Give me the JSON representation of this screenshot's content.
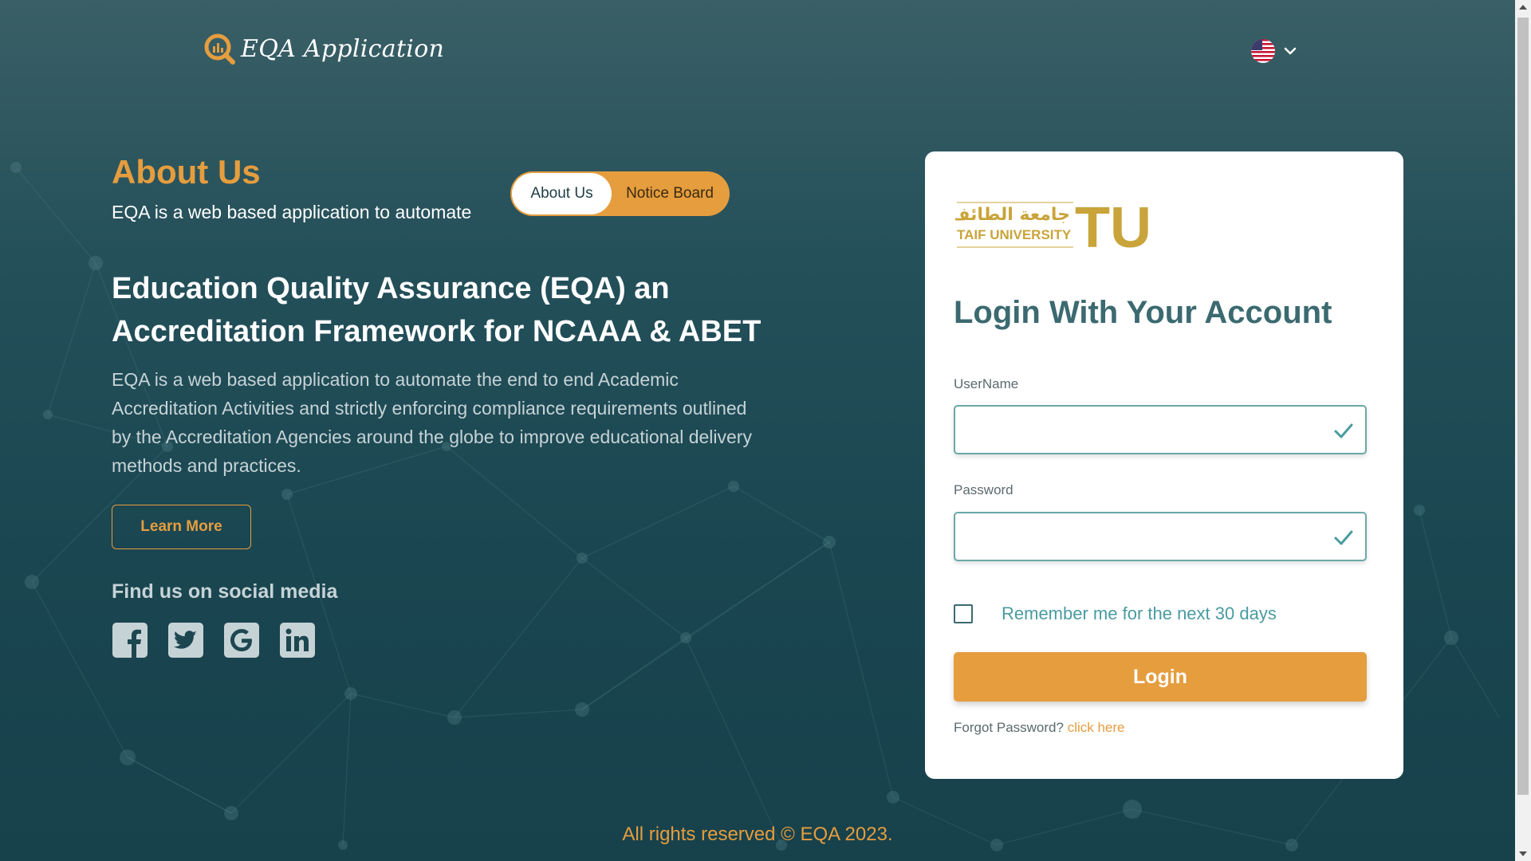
{
  "header": {
    "brand_title": "EQA Application",
    "language_flag": "us-flag-icon"
  },
  "about": {
    "heading": "About Us",
    "subtitle": "EQA is a web based application to automate",
    "toggle": [
      "About Us",
      "Notice Board"
    ],
    "title": "Education Quality Assurance (EQA) an Accreditation Framework for NCAAA & ABET",
    "description": "EQA is a web based application to automate the end to end Academic Accreditation Activities and strictly enforcing compliance requirements outlined by the Accreditation Agencies around the globe to improve educational delivery methods and practices.",
    "learn_more": "Learn More"
  },
  "social": {
    "heading": "Find us on social media",
    "icons": [
      "facebook-icon",
      "twitter-icon",
      "google-icon",
      "linkedin-icon"
    ]
  },
  "login": {
    "logo_arabic": "جامعة الطائف",
    "logo_english": "TAIF UNIVERSITY",
    "logo_mark": "TU",
    "title": "Login With Your Account",
    "username_label": "UserName",
    "username_value": "",
    "password_label": "Password",
    "password_value": "",
    "remember_label": "Remember me for the next 30 days",
    "remember_checked": false,
    "login_button": "Login",
    "forgot_text": "Forgot Password?",
    "forgot_link": "click here"
  },
  "footer": {
    "text": "All rights reserved © EQA 2023."
  },
  "colors": {
    "accent": "#e59d3e",
    "teal_dark": "#1a4651",
    "teal_text": "#3b6a70",
    "field_border": "#6aa8a6"
  }
}
